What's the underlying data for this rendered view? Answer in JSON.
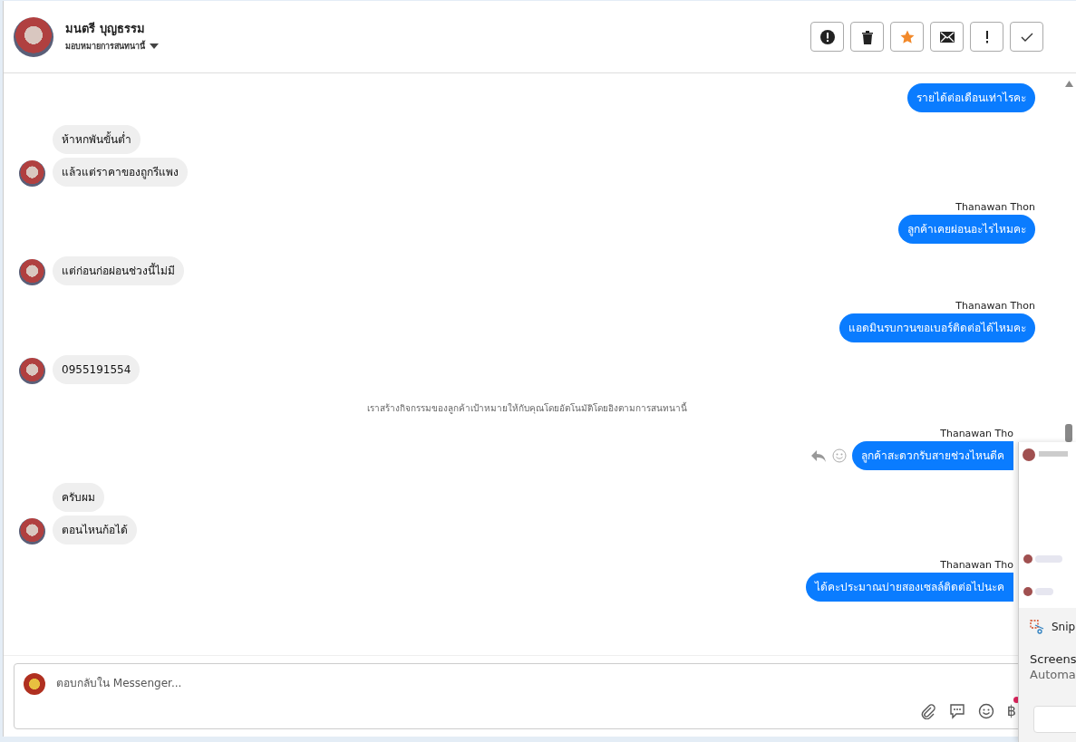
{
  "header": {
    "name": "มนตรี บุญธรรม",
    "assign_label": "มอบหมายการสนทนานี้"
  },
  "toolbar": [
    {
      "kind": "alert"
    },
    {
      "kind": "trash"
    },
    {
      "kind": "star"
    },
    {
      "kind": "mail"
    },
    {
      "kind": "exclaim"
    },
    {
      "kind": "check"
    }
  ],
  "messages": [
    {
      "kind": "outgoing",
      "text": "รายได้ต่อเดือนเท่าไรคะ",
      "partly_hidden": false,
      "actions": false
    },
    {
      "kind": "incoming",
      "texts": [
        "ห้าหกพันขั้นต่ำ",
        "แล้วแต่ราคาของถูกรีแพง"
      ]
    },
    {
      "kind": "outgoing",
      "sender": "Thanawan Thon",
      "text": "ลูกค้าเคยผ่อนอะไรไหมคะ",
      "partly_hidden": false,
      "actions": false
    },
    {
      "kind": "incoming",
      "texts": [
        "แต่ก่อนก่อผ่อนช่วงนี้ไม่มี"
      ]
    },
    {
      "kind": "outgoing",
      "sender": "Thanawan Thon",
      "text": "แอดมินรบกวนขอเบอร์ติดต่อได้ไหมคะ",
      "partly_hidden": false,
      "actions": false
    },
    {
      "kind": "incoming",
      "texts": [
        "0955191554"
      ]
    },
    {
      "kind": "notice",
      "text": "เราสร้างกิจกรรมของลูกค้าเป้าหมายให้กับคุณโดยอัตโนมัติโดยอิงตามการสนทนานี้"
    },
    {
      "kind": "outgoing",
      "sender": "Thanawan Tho",
      "text": "ลูกค้าสะดวกรับสายช่วงไหนดีค",
      "partly_hidden": true,
      "actions": true
    },
    {
      "kind": "incoming",
      "texts": [
        "ครับผม",
        "ตอนไหนก้อได้"
      ]
    },
    {
      "kind": "outgoing",
      "sender": "Thanawan Tho",
      "text": "ได้คะประมาณบ่ายสองเซลล์ติดต่อไปนะค",
      "partly_hidden": true,
      "actions": false
    }
  ],
  "composer": {
    "placeholder": "ตอบกลับใน Messenger...",
    "currency_symbol": "฿"
  },
  "snip_toast": {
    "title": "Snip",
    "line_1": "Screens",
    "line_2": "Automa"
  }
}
